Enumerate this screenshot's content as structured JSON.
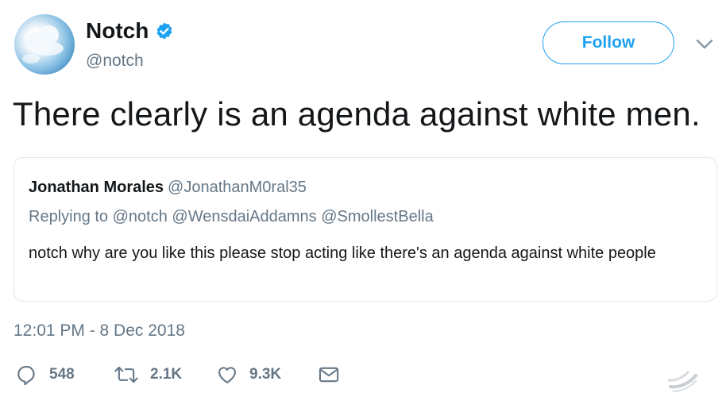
{
  "author": {
    "display_name": "Notch",
    "handle": "@notch",
    "verified": true,
    "avatar_icon": "sky-cloud-avatar"
  },
  "follow": {
    "label": "Follow",
    "color": "#1da1f2"
  },
  "menu": {
    "icon": "chevron-down-icon"
  },
  "tweet": {
    "text": "There clearly is an agenda against white men.",
    "timestamp": "12:01 PM - 8 Dec 2018"
  },
  "quoted": {
    "name": "Jonathan Morales",
    "handle": "@JonathanM0ral35",
    "replying_prefix": "Replying to",
    "replying_to": [
      "@notch",
      "@WensdaiAddamns",
      "@SmollestBella"
    ],
    "text": "notch why are you like this please stop acting like there's an agenda against white people"
  },
  "actions": {
    "reply": {
      "icon": "reply-icon",
      "count": "548"
    },
    "retweet": {
      "icon": "retweet-icon",
      "count": "2.1K"
    },
    "like": {
      "icon": "heart-icon",
      "count": "9.3K"
    },
    "dm": {
      "icon": "envelope-icon"
    }
  },
  "colors": {
    "text": "#14171a",
    "secondary": "#657786",
    "accent": "#1da1f2",
    "border": "#e1e8ed"
  }
}
